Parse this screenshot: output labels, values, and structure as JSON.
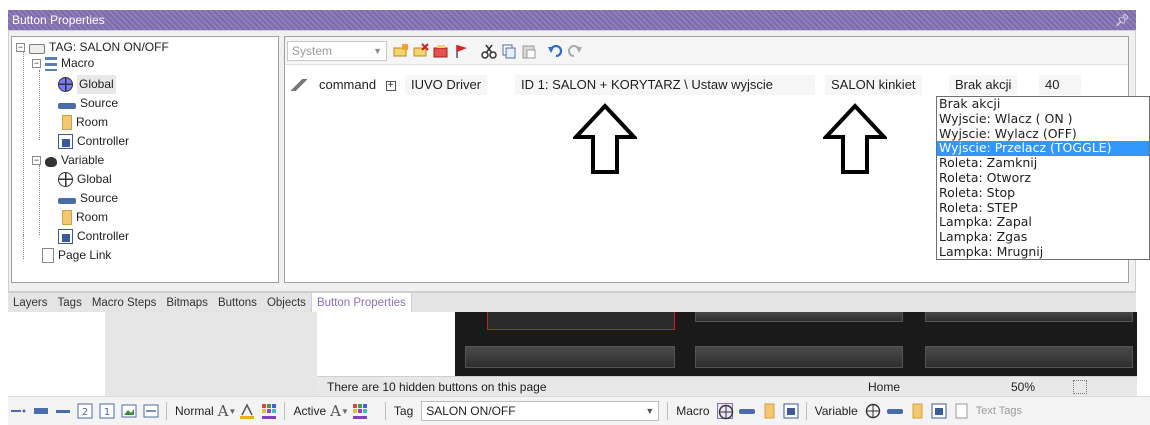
{
  "window": {
    "title": "Button Properties",
    "pin_glyph": "↑"
  },
  "tree": {
    "items": [
      {
        "label": "TAG: SALON ON/OFF",
        "icon": "tag-icon"
      },
      {
        "label": "Macro",
        "icon": "macro-icon"
      },
      {
        "label": "Global",
        "icon": "globe-icon"
      },
      {
        "label": "Source",
        "icon": "source-icon"
      },
      {
        "label": "Room",
        "icon": "room-icon"
      },
      {
        "label": "Controller",
        "icon": "controller-icon"
      },
      {
        "label": "Variable",
        "icon": "variable-icon"
      },
      {
        "label": "Global",
        "icon": "globe-icon"
      },
      {
        "label": "Source",
        "icon": "source-icon"
      },
      {
        "label": "Room",
        "icon": "room-icon"
      },
      {
        "label": "Controller",
        "icon": "controller-icon"
      },
      {
        "label": "Page Link",
        "icon": "page-icon"
      }
    ]
  },
  "editor": {
    "system_combo": "System",
    "command": {
      "label": "command",
      "expand": "⊞",
      "driver": "IUVO Driver",
      "id": "ID 1: SALON + KORYTARZ \\ Ustaw wyjscie",
      "target": "SALON kinkiet",
      "action": "Brak akcji",
      "value": "40"
    }
  },
  "dropdown": {
    "selected_index": 3,
    "options": [
      "Brak akcji",
      "Wyjscie: Wlacz ( ON )",
      "Wyjscie: Wylacz (OFF)",
      "Wyjscie: Przelacz (TOGGLE)",
      "Roleta: Zamknij",
      "Roleta: Otworz",
      "Roleta: Stop",
      "Roleta: STEP",
      "Lampka: Zapal",
      "Lampka: Zgas",
      "Lampka: Mrugnij"
    ]
  },
  "tabs": [
    "Layers",
    "Tags",
    "Macro Steps",
    "Bitmaps",
    "Buttons",
    "Objects",
    "Button Properties"
  ],
  "active_tab_index": 6,
  "status": {
    "hidden_text": "There are 10 hidden buttons on this page",
    "page": "Home",
    "zoom": "50%"
  },
  "bottom": {
    "normal_label": "Normal",
    "active_label": "Active",
    "tag_label": "Tag",
    "tag_value": "SALON ON/OFF",
    "macro_label": "Macro",
    "variable_label": "Variable",
    "text_tags_label": "Text Tags",
    "font_glyph": "A",
    "num_2": "2",
    "num_1": "1"
  },
  "colors": {
    "title_bg": "#7c6aab",
    "selection": "#3296fa",
    "active_tab_text": "#8a6fba"
  }
}
